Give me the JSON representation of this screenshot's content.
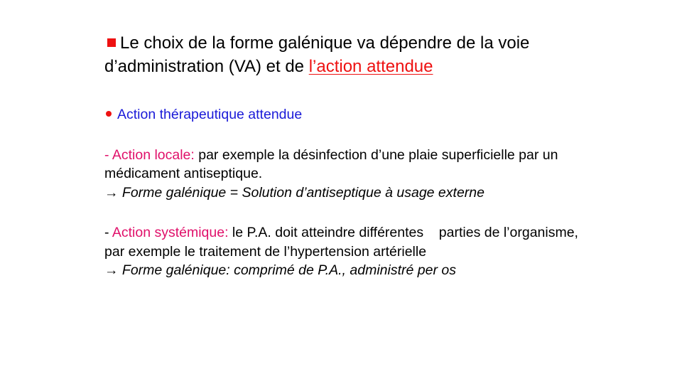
{
  "slide": {
    "headline": {
      "text_before": "Le choix de la forme galénique va dépendre de la voie d’administration (VA) et de ",
      "highlight": "l’action attendue"
    },
    "subtitle": "Action thérapeutique attendue",
    "local": {
      "dash": "- ",
      "label": "Action locale:",
      "text": " par exemple la désinfection d’une plaie superficielle par un médicament antiseptique.",
      "arrow": "→",
      "conclusion": " Forme galénique = Solution d’antiseptique à usage externe"
    },
    "systemic": {
      "dash": "- ",
      "label": "Action systémique:",
      "text": " le P.A. doit atteindre différentes    parties de l’organisme, par exemple le traitement de l’hypertension artérielle",
      "arrow": "→",
      "conclusion": " Forme galénique: comprimé de P.A., administré per os"
    },
    "colors": {
      "bullet_red": "#ee1111",
      "subtitle_blue": "#1a1ad8",
      "label_magenta": "#e0106a"
    }
  }
}
